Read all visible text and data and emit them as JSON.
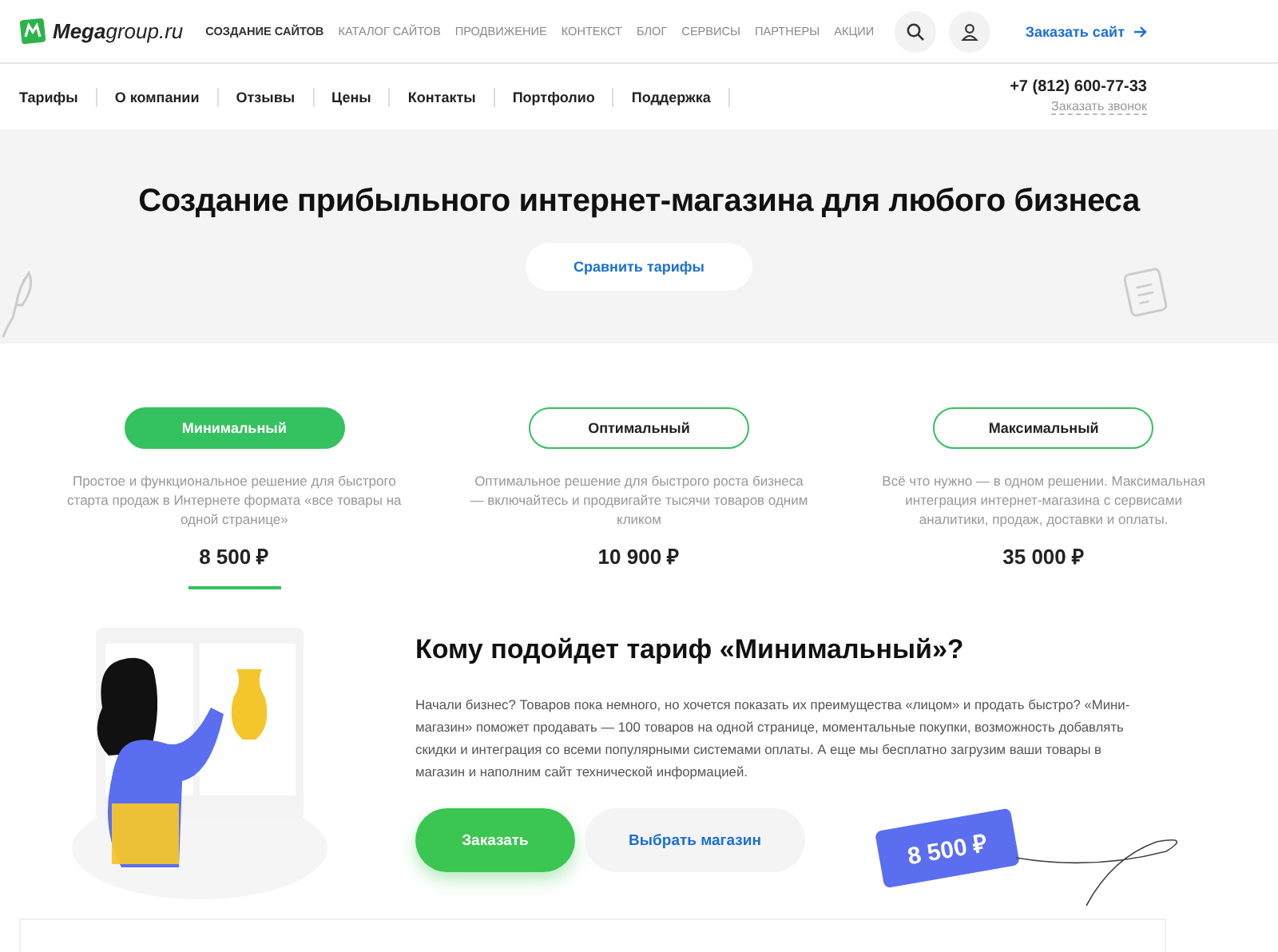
{
  "header": {
    "logo": "**Mega**group.ru",
    "nav": [
      {
        "label": "СОЗДАНИЕ САЙТОВ",
        "selected": true
      },
      {
        "label": "КАТАЛОГ САЙТОВ",
        "selected": false
      },
      {
        "label": "ПРОДВИЖЕНИЕ",
        "selected": false
      },
      {
        "label": "КОНТЕКСТ",
        "selected": false
      },
      {
        "label": "БЛОГ",
        "selected": false
      },
      {
        "label": "СЕРВИСЫ",
        "selected": false
      },
      {
        "label": "ПАРТНЕРЫ",
        "selected": false
      },
      {
        "label": "АКЦИИ",
        "selected": false
      }
    ],
    "order_link": "Заказать сайт"
  },
  "subnav": {
    "items": [
      "Тарифы",
      "О компании",
      "Отзывы",
      "Цены",
      "Контакты",
      "Портфолио",
      "Поддержка"
    ],
    "phone": "+7 (812) 600-77-33",
    "callback": "Заказать звонок"
  },
  "hero": {
    "title": "Создание прибыльного интернет-магазина для любого бизнеса",
    "button": "Сравнить тарифы"
  },
  "tariffs": [
    {
      "name": "Минимальный",
      "selected": true,
      "description": "Простое и функциональное решение для быстрого старта продаж в Интернете формата «все товары на одной странице»",
      "price": "8 500 ₽"
    },
    {
      "name": "Оптимальный",
      "selected": false,
      "description": "Оптимальное решение для быстрого роста бизнеса — включайтесь и продвигайте тысячи товаров одним кликом",
      "price": "10 900 ₽"
    },
    {
      "name": "Максимальный",
      "selected": false,
      "description": "Всё что нужно — в одном решении. Максимальная интеграция интернет-магазина с сервисами аналитики, продаж, доставки и оплаты.",
      "price": "35 000 ₽"
    }
  ],
  "detail": {
    "title": "Кому подойдет тариф «Минимальный»?",
    "text": "Начали бизнес? Товаров пока немного, но хочется показать их преимущества «лицом» и продать быстро? «Мини-магазин» поможет продавать — 100 товаров на одной странице, моментальные покупки, возможность добавлять скидки и интеграция со всеми популярными системами оплаты. А еще мы бесплатно загрузим ваши товары в магазин и наполним сайт технической информацией.",
    "buttons": [
      {
        "label": "Заказать",
        "kind": "primary"
      },
      {
        "label": "Выбрать магазин",
        "kind": "secondary"
      }
    ],
    "price_tag": "8 500 ₽"
  }
}
